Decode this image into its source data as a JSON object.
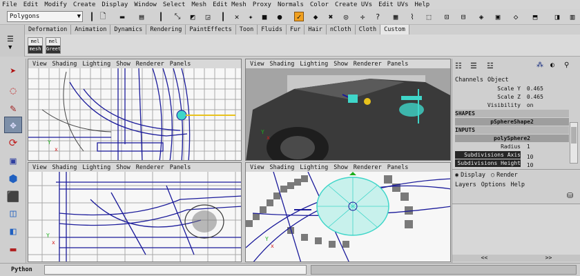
{
  "menubar": [
    "File",
    "Edit",
    "Modify",
    "Create",
    "Display",
    "Window",
    "Select",
    "Mesh",
    "Edit Mesh",
    "Proxy",
    "Normals",
    "Color",
    "Create UVs",
    "Edit UVs",
    "Help"
  ],
  "status_line": {
    "mode": "Polygons"
  },
  "shelf_tabs": [
    "Deformation",
    "Animation",
    "Dynamics",
    "Rendering",
    "PaintEffects",
    "Toon",
    "Fluids",
    "Fur",
    "Hair",
    "nCloth",
    "Cloth",
    "Custom"
  ],
  "shelf_active_tab": "Custom",
  "shelf_buttons": [
    "mel",
    "mel"
  ],
  "shelf_button_captions": [
    "mesh",
    "Greet"
  ],
  "viewport_menu": [
    "View",
    "Shading",
    "Lighting",
    "Show",
    "Renderer",
    "Panels"
  ],
  "viewports": {
    "top_left": {
      "menu": [
        "View",
        "Shading",
        "Lighting",
        "Show",
        "Renderer",
        "Panels"
      ]
    },
    "top_right": {
      "menu": [
        "View",
        "Shading",
        "Lighting",
        "Show",
        "Renderer",
        "Panels"
      ]
    },
    "bottom_left": {
      "menu": [
        "View",
        "Shading",
        "Lighting",
        "Show",
        "Renderer",
        "Panels"
      ]
    },
    "bottom_right": {
      "menu": [
        "View",
        "Shading",
        "Lighting",
        "Show",
        "Renderer",
        "Panels"
      ]
    }
  },
  "channel_box": {
    "menu": [
      "Channels",
      "Object"
    ],
    "attrs_top": [
      {
        "name": "Scale Y",
        "value": "0.465"
      },
      {
        "name": "Scale Z",
        "value": "0.465"
      },
      {
        "name": "Visibility",
        "value": "on"
      }
    ],
    "shapes_label": "SHAPES",
    "shape_name": "pSphereShape2",
    "inputs_label": "INPUTS",
    "input_name": "polySphere2",
    "attrs_bottom": [
      {
        "name": "Radius",
        "value": "1"
      },
      {
        "name": "Subdivisions Axis",
        "value": "10"
      },
      {
        "name": "Subdivisions Height",
        "value": "10"
      }
    ],
    "layer_radio_display": "Display",
    "layer_radio_render": "Render",
    "layer_menu": [
      "Layers",
      "Options",
      "Help"
    ]
  },
  "command_line": {
    "label": "Python",
    "value": ""
  },
  "colors": {
    "wire_blue": "#1a1a9a",
    "grid": "#9a9a9a",
    "selected_cyan": "#3fd6c9",
    "manip_yellow": "#e8c21c",
    "manip_red": "#d11c1c",
    "manip_green": "#1cae1c"
  }
}
